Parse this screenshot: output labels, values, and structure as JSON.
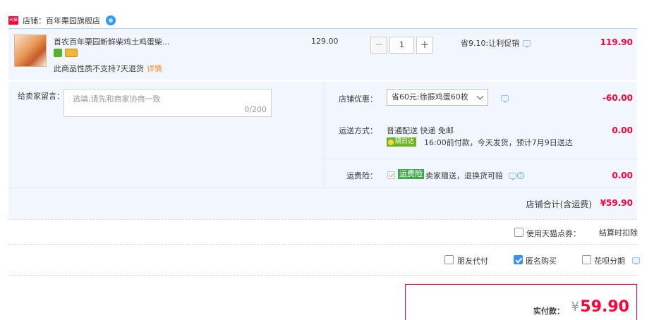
{
  "shop": {
    "badge": "天猫",
    "name": "店铺：百年栗园旗舰店"
  },
  "item": {
    "title": "首农百年栗园新鲜柴鸡土鸡蛋柴...",
    "note": "此商品性质不支持7天退货",
    "note_link": "详情",
    "unit_price": "129.00",
    "quantity": "1",
    "minus": "−",
    "plus": "+",
    "promo": "省9.10:让利促销",
    "total": "119.90"
  },
  "message": {
    "label": "给卖家留言：",
    "placeholder": "选填,请先和商家协商一致",
    "count": "0/200"
  },
  "coupon": {
    "label": "店铺优惠：",
    "selected": "省60元:徐振鸡蛋60枚",
    "amount": "-60.00"
  },
  "shipping": {
    "label": "运送方式：",
    "method": "普通配送 快递 免邮",
    "badge": "隔日达",
    "detail": "16:00前付款，今天发货，预计7月9日送达",
    "amount": "0.00"
  },
  "insurance": {
    "label": "运费险：",
    "tag": "运费险",
    "text": "卖家赠送，退换货可赔",
    "help": "?",
    "amount": "0.00"
  },
  "shop_total": {
    "label": "店铺合计(含运费)",
    "value": "¥59.90"
  },
  "points": {
    "label": "使用天猫点券：",
    "note": "结算时扣除"
  },
  "options": {
    "friend_pay": "朋友代付",
    "anonymous": "匿名购买",
    "anonymous_checked": true,
    "huabei": "花呗分期"
  },
  "payment": {
    "label": "实付款：",
    "currency": "¥",
    "amount": "59.90"
  },
  "colors": {
    "accent": "#ff0036",
    "row_bg": "#f2f7ff",
    "check_blue": "#3d8ef7"
  }
}
